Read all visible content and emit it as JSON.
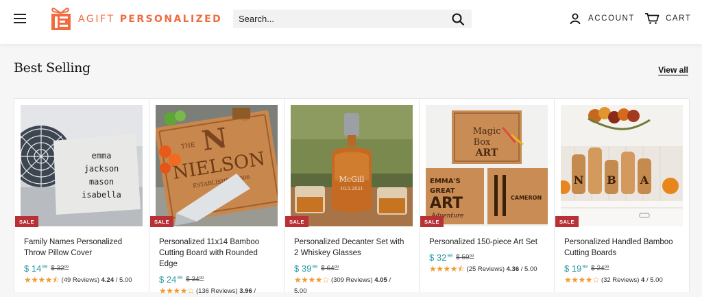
{
  "header": {
    "logo": {
      "light": "AGIFT",
      "bold": "PERSONALIZED"
    },
    "search_placeholder": "Search...",
    "account_label": "ACCOUNT",
    "cart_label": "CART"
  },
  "section": {
    "title": "Best Selling",
    "view_all": "View all"
  },
  "colors": {
    "brand": "#f06b3f",
    "price": "#2a9aa6",
    "sale": "#b73137",
    "star": "#f09b35"
  },
  "products": [
    {
      "title": "Family Names Personalized Throw Pillow Cover",
      "price_whole": "$ 14",
      "price_cents": "99",
      "compare_whole": "$ 32",
      "compare_cents": "99",
      "rating_stars": 4.5,
      "reviews": "(49 Reviews)",
      "score": "4.24",
      "score_max": "/ 5.00",
      "sale": "SALE",
      "pillow_names": [
        "emma",
        "jackson",
        "mason",
        "isabella"
      ]
    },
    {
      "title": "Personalized 11x14 Bamboo Cutting Board with Rounded Edge",
      "price_whole": "$ 24",
      "price_cents": "99",
      "compare_whole": "$ 34",
      "compare_cents": "99",
      "rating_stars": 4,
      "reviews": "(136 Reviews)",
      "score": "3.96",
      "score_max": "/",
      "sale": "SALE",
      "board_text": [
        "THE",
        "N",
        "NIELSON",
        "ESTABLISHED 2006"
      ]
    },
    {
      "title": "Personalized Decanter Set with 2 Whiskey Glasses",
      "price_whole": "$ 39",
      "price_cents": "99",
      "compare_whole": "$ 64",
      "compare_cents": "99",
      "rating_stars": 4,
      "reviews": "(309 Reviews)",
      "score": "4.05",
      "score_max": "/ 5.00",
      "sale": "SALE",
      "decanter_text": [
        "McGill",
        "10.5.2021"
      ]
    },
    {
      "title": "Personalized 150-piece Art Set",
      "price_whole": "$ 32",
      "price_cents": "99",
      "compare_whole": "$ 59",
      "compare_cents": "99",
      "rating_stars": 4.5,
      "reviews": "(25 Reviews)",
      "score": "4.36",
      "score_max": "/ 5.00",
      "sale": "SALE",
      "art_text": [
        "Magic",
        "Box",
        "ART",
        "EMMA'S",
        "GREAT",
        "ART",
        "Adventure",
        "CAMERON"
      ]
    },
    {
      "title": "Personalized Handled Bamboo Cutting Boards",
      "price_whole": "$ 19",
      "price_cents": "99",
      "compare_whole": "$ 24",
      "compare_cents": "99",
      "rating_stars": 4,
      "reviews": "(32 Reviews)",
      "score": "4",
      "score_max": "/ 5.00",
      "sale": "SALE",
      "letters": [
        "N",
        "B",
        "A"
      ]
    }
  ]
}
